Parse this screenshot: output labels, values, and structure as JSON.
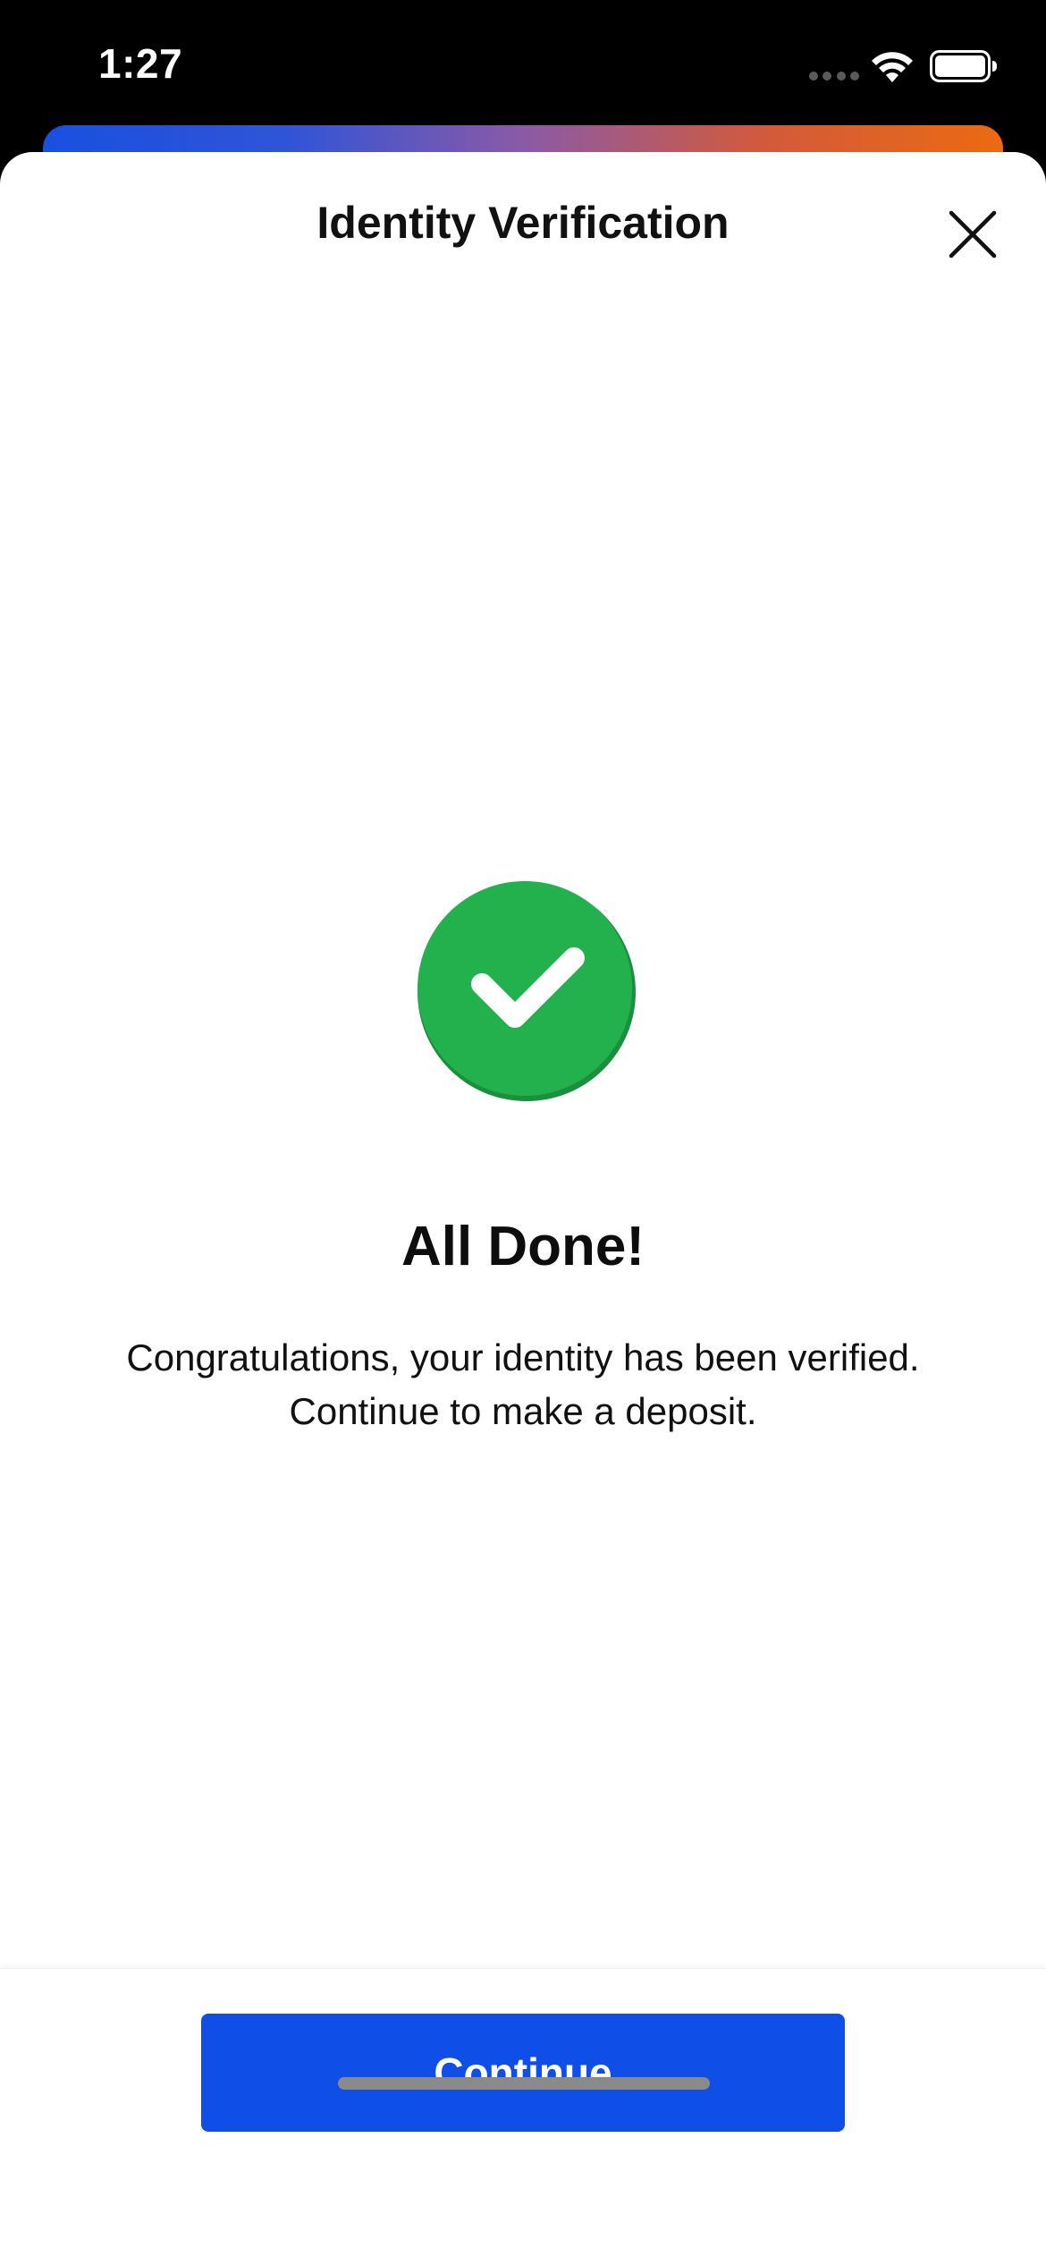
{
  "status_bar": {
    "time": "1:27",
    "icons": [
      "cellular-dots-icon",
      "wifi-icon",
      "battery-icon"
    ]
  },
  "gradient": {
    "colors": [
      "#1a4fe0",
      "#2f54d8",
      "#8a5aa6",
      "#d25a3c",
      "#ec6a10"
    ]
  },
  "sheet": {
    "title": "Identity Verification",
    "close_icon": "close-icon"
  },
  "result": {
    "icon": "check-circle-icon",
    "icon_color": "#22b14c",
    "heading": "All Done!",
    "message_line1": "Congratulations, your identity has been verified.",
    "message_line2": "Continue to make a deposit."
  },
  "footer": {
    "continue_label": "Continue",
    "button_color": "#0f4fe8"
  }
}
